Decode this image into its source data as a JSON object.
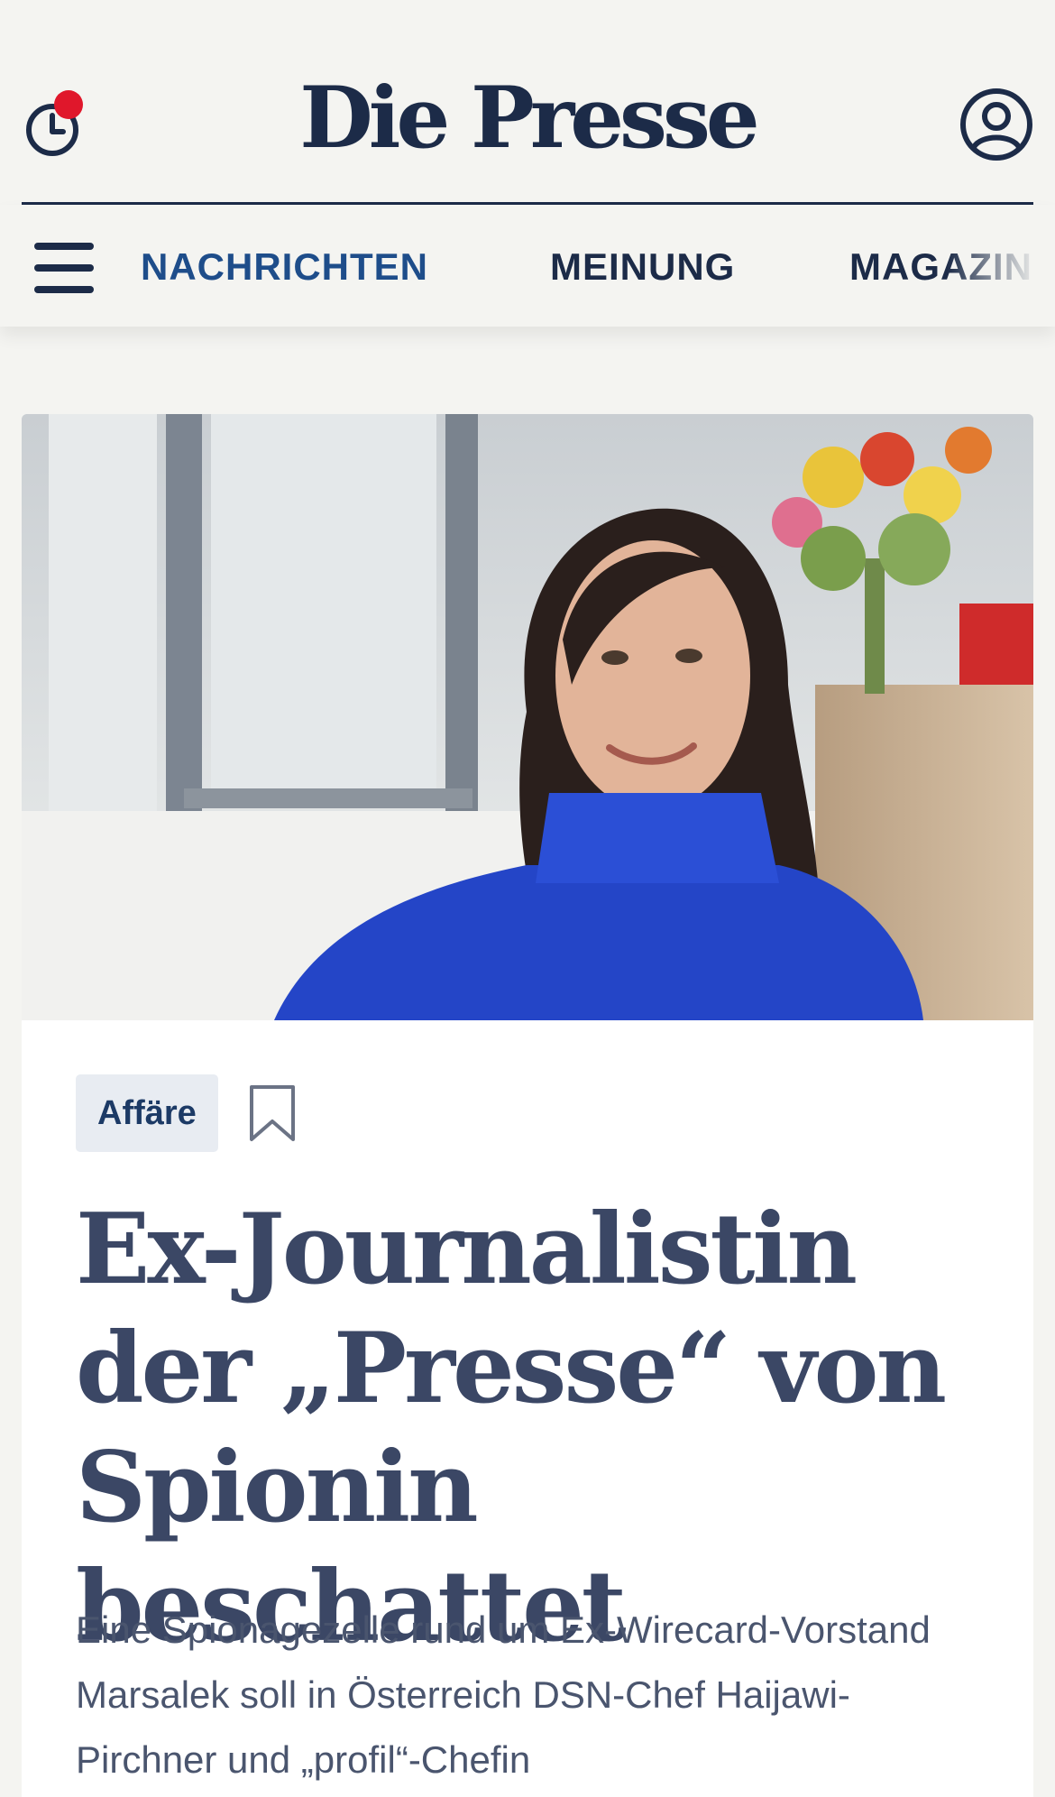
{
  "header": {
    "logo": "Die Presse"
  },
  "nav": {
    "items": [
      {
        "label": "NACHRICHTEN",
        "active": true
      },
      {
        "label": "MEINUNG",
        "active": false
      },
      {
        "label": "MAGAZIN",
        "active": false
      }
    ]
  },
  "article": {
    "tag": "Affäre",
    "headline": "Ex-Journalistin der „Presse“ von Spionin beschattet",
    "lead": "Eine Spionagezelle rund um Ex-Wirecard-Vorstand Marsalek soll in Österreich DSN-Chef Haijawi-Pirchner und „profil“-Chefin"
  },
  "colors": {
    "brand_navy": "#1c2b48",
    "nav_active": "#1e4d8a",
    "notification": "#e0172b",
    "tag_bg": "#e8ecf2"
  },
  "icons": {
    "history": "clock-icon",
    "account": "user-icon",
    "menu": "hamburger-icon",
    "bookmark": "bookmark-icon"
  }
}
